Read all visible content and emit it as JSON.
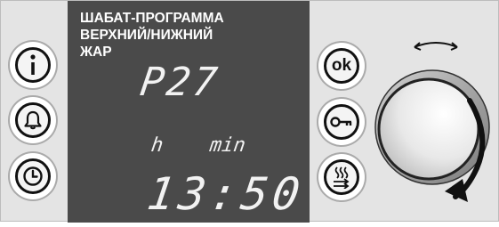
{
  "display": {
    "title_line1": "ШАБАТ-ПРОГРАММА",
    "title_line2": "ВЕРХНИЙ/НИЖНИЙ",
    "title_line3": "ЖАР",
    "program_code": "P27",
    "unit_hours": "h",
    "unit_minutes": "min",
    "time": "13:50"
  },
  "buttons": {
    "ok_label": "ok"
  },
  "icons": {
    "info": "info-icon",
    "bell": "bell-icon",
    "clock": "clock-icon",
    "ok": "ok-label",
    "key": "key-icon",
    "steam": "steam-icon",
    "rotate": "double-arrow-icon",
    "knob": "dial-knob"
  },
  "colors": {
    "display_bg": "#4a4a4a",
    "panel_bg": "#e4e4e4",
    "display_text": "#ffffff"
  }
}
